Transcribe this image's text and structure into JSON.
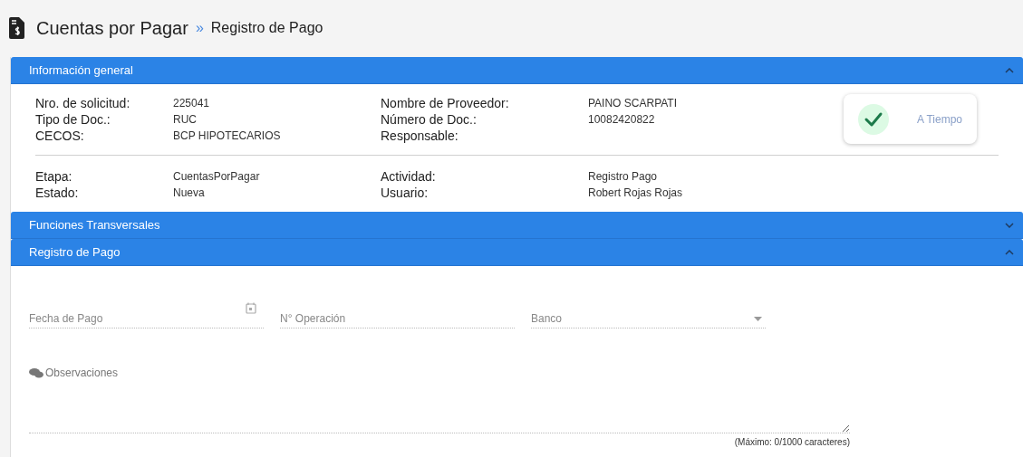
{
  "header": {
    "title": "Cuentas por Pagar",
    "separator": "»",
    "subtitle": "Registro de Pago"
  },
  "sections": [
    {
      "title": "Información general",
      "expanded": true,
      "kind": "info"
    },
    {
      "title": "Funciones Transversales",
      "expanded": false
    },
    {
      "title": "Registro de Pago",
      "expanded": true,
      "kind": "form"
    }
  ],
  "info": {
    "groups": [
      [
        {
          "label_1": "Nro. de solicitud:",
          "value_1": "225041",
          "label_2": "Nombre de Proveedor:",
          "value_2": "PAINO SCARPATI"
        },
        {
          "label_1": "Tipo de Doc.:",
          "value_1": "RUC",
          "label_2": "Número de Doc.:",
          "value_2": "10082420822"
        },
        {
          "label_1": "CECOS:",
          "value_1": "BCP HIPOTECARIOS",
          "label_2": "Responsable:"
        }
      ],
      [
        {
          "label_1": "Etapa:",
          "value_1": "CuentasPorPagar",
          "label_2": "Actividad:",
          "value_2": "Registro Pago"
        },
        {
          "label_1": "Estado:",
          "value_1": "Nueva",
          "label_2": "Usuario:",
          "value_2": "Robert Rojas Rojas"
        }
      ]
    ],
    "status": {
      "label": "A Tiempo",
      "kind": "ok"
    }
  },
  "form": {
    "fields": [
      {
        "placeholder": "Fecha de Pago",
        "kind": "date"
      },
      {
        "placeholder": "N° Operación",
        "kind": "text"
      },
      {
        "placeholder": "Banco",
        "kind": "select"
      }
    ],
    "notes": {
      "label": "Observaciones",
      "counter": "(Máximo: 0/1000 caracteres)"
    }
  }
}
